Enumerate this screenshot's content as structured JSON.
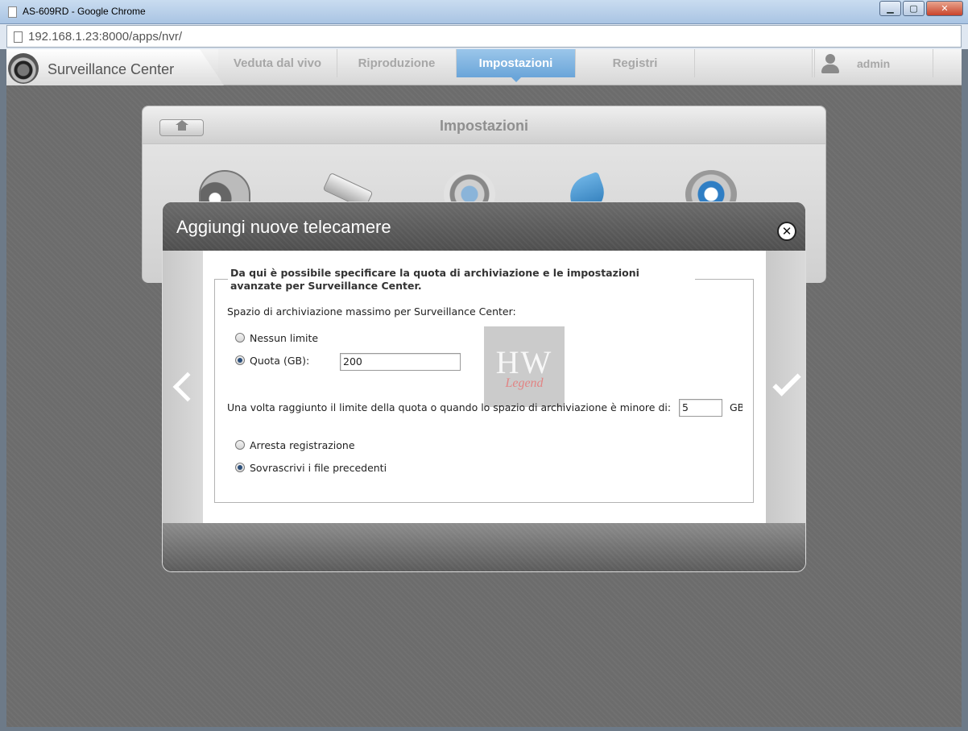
{
  "window": {
    "title": "AS-609RD - Google Chrome",
    "minimize": "▁",
    "maximize": "▢",
    "close": "✕"
  },
  "browser": {
    "url": "192.168.1.23:8000/apps/nvr/"
  },
  "app": {
    "name": "Surveillance Center",
    "tabs": [
      {
        "label": "Veduta dal vivo"
      },
      {
        "label": "Riproduzione"
      },
      {
        "label": "Impostazioni",
        "active": true
      },
      {
        "label": "Registri"
      }
    ],
    "user": "admin"
  },
  "settings_panel": {
    "title": "Impostazioni",
    "icons": [
      "performance-icon",
      "camera-icon",
      "user-management-icon",
      "bird-icon",
      "gear-icon"
    ]
  },
  "modal": {
    "title": "Aggiungi nuove telecamere",
    "close_glyph": "✕",
    "legend": "Da qui è possibile specificare la quota di archiviazione e le impostazioni avanzate per Surveillance Center.",
    "storage_label": "Spazio di archiviazione massimo per Surveillance Center:",
    "option_no_limit": "Nessun limite",
    "option_quota": "Quota (GB):",
    "quota_value": "200",
    "threshold_label": "Una volta raggiunto il limite della quota o quando lo spazio di archiviazione è minore di:",
    "threshold_value": "5",
    "threshold_unit": "GB",
    "option_stop": "Arresta registrazione",
    "option_overwrite": "Sovrascrivi i file precedenti",
    "watermark_big": "HW",
    "watermark_small": "Legend"
  },
  "colors": {
    "accent_tab": "#6aa5d9",
    "modal_header": "#575757",
    "backdrop": "#6c6c6c"
  }
}
